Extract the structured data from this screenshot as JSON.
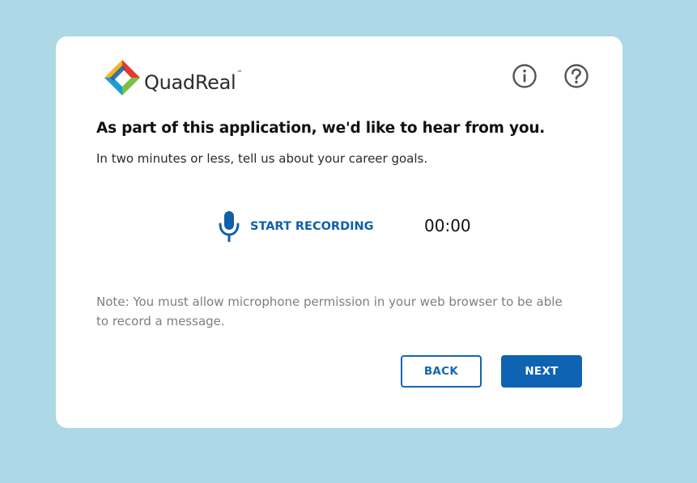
{
  "brand": {
    "name": "QuadReal",
    "trademark": "™",
    "logo_colors": [
      "#e63a2e",
      "#7ac143",
      "#f7b21b",
      "#1e9bd7",
      "#1560ad"
    ]
  },
  "header": {
    "info_icon": "info-circle-icon",
    "help_icon": "question-circle-icon"
  },
  "main": {
    "headline": "As part of this application, we'd like to hear from you.",
    "prompt": "In two minutes or less, tell us about your career goals.",
    "record_label": "START RECORDING",
    "mic_icon": "microphone-icon",
    "timer": "00:00",
    "note": "Note: You must allow microphone permission in your web browser to be able to record a message."
  },
  "actions": {
    "back_label": "BACK",
    "next_label": "NEXT"
  },
  "colors": {
    "background": "#add8e6",
    "card": "#ffffff",
    "accent": "#0e63b3",
    "note_text": "#7e7e7e"
  }
}
